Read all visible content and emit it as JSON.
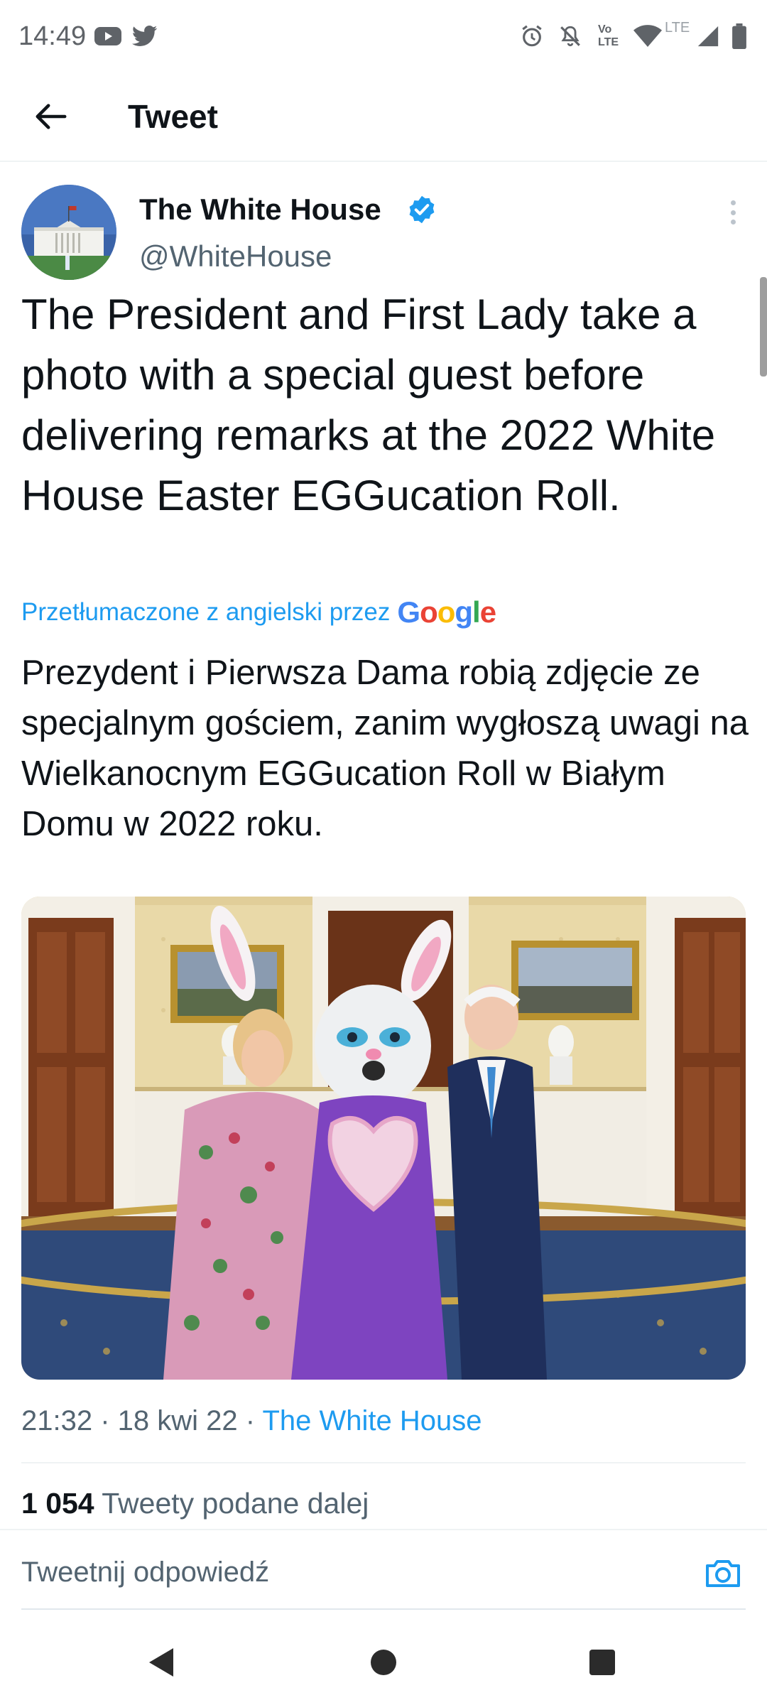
{
  "status_bar": {
    "time": "14:49",
    "icons_left": [
      "youtube-icon",
      "twitter-icon"
    ],
    "icons_right": [
      "alarm-icon",
      "mute-icon",
      "volte-icon",
      "wifi-icon",
      "lte-signal-icon",
      "battery-icon"
    ],
    "volte_text": "Vo LTE",
    "lte_text": "LTE"
  },
  "app_bar": {
    "title": "Tweet"
  },
  "tweet": {
    "author_name": "The White House",
    "author_handle": "@WhiteHouse",
    "verified": true,
    "text": "The President and First Lady take a photo with a special guest before delivering remarks at the 2022 White House Easter EGGucation Roll.",
    "translated_label": "Przetłumaczone z angielski przez",
    "translator": "Google",
    "translation": "Prezydent i Pierwsza Dama robią zdjęcie ze specjalnym gościem, zanim wygłoszą uwagi na Wielkanocnym EGGucation Roll w Białym Domu w 2022 roku.",
    "meta": {
      "time": "21:32",
      "separator": " · ",
      "date": "18 kwi 22",
      "source": "The White House"
    },
    "retweets": {
      "count": "1 054",
      "label": "Tweety podane dalej"
    }
  },
  "reply": {
    "placeholder": "Tweetnij odpowiedź"
  },
  "colors": {
    "accent": "#1d9bf0",
    "text_primary": "#0f1419",
    "text_secondary": "#536471"
  }
}
